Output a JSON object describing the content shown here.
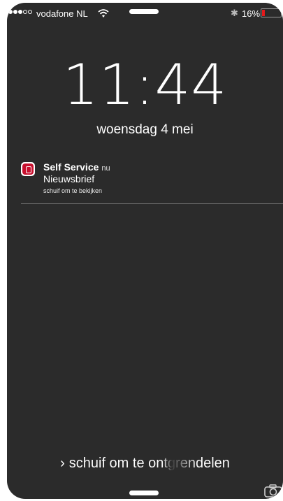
{
  "status_bar": {
    "carrier": "vodafone NL",
    "signal_bars_filled": 3,
    "signal_bars_total": 5,
    "battery_percent_text": "16%",
    "battery_level": 0.16,
    "battery_color": "#e5191b",
    "icons": [
      "wifi-icon",
      "bluetooth-icon",
      "battery-icon"
    ]
  },
  "lock_screen": {
    "time": "11:44",
    "date": "woensdag 4 mei",
    "unlock_prompt": "schuif om te ontgrendelen",
    "unlock_chevron": "›"
  },
  "notification": {
    "app_name": "Self Service",
    "time": "nu",
    "message": "Nieuwsbrief",
    "hint": "schuif om te bekijken",
    "icon": "self-service-app-icon",
    "icon_color": "#c8102e"
  },
  "colors": {
    "screen_background": "#2b2b2b",
    "text": "#ffffff",
    "divider": "#6b6b6b"
  }
}
